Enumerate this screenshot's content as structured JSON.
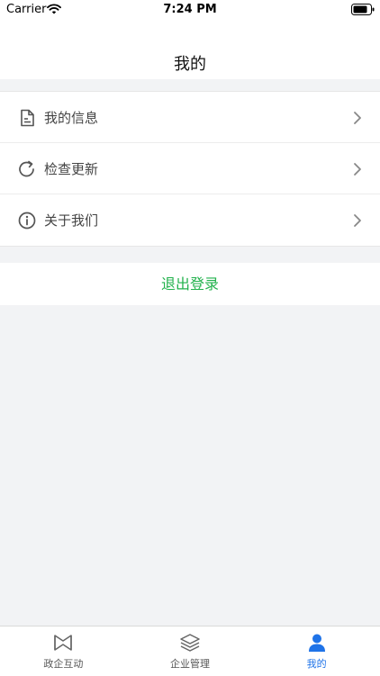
{
  "status_bar": {
    "carrier": "Carrier",
    "time": "7:24 PM"
  },
  "header": {
    "title": "我的"
  },
  "menu": {
    "items": [
      {
        "label": "我的信息",
        "icon": "document-icon"
      },
      {
        "label": "检查更新",
        "icon": "refresh-icon"
      },
      {
        "label": "关于我们",
        "icon": "info-icon"
      }
    ]
  },
  "logout": {
    "label": "退出登录",
    "color": "#22b24c"
  },
  "tabbar": {
    "active_color": "#1f73e8",
    "tabs": [
      {
        "label": "政企互动",
        "icon": "bowtie-icon",
        "active": false
      },
      {
        "label": "企业管理",
        "icon": "layers-icon",
        "active": false
      },
      {
        "label": "我的",
        "icon": "user-icon",
        "active": true
      }
    ]
  }
}
